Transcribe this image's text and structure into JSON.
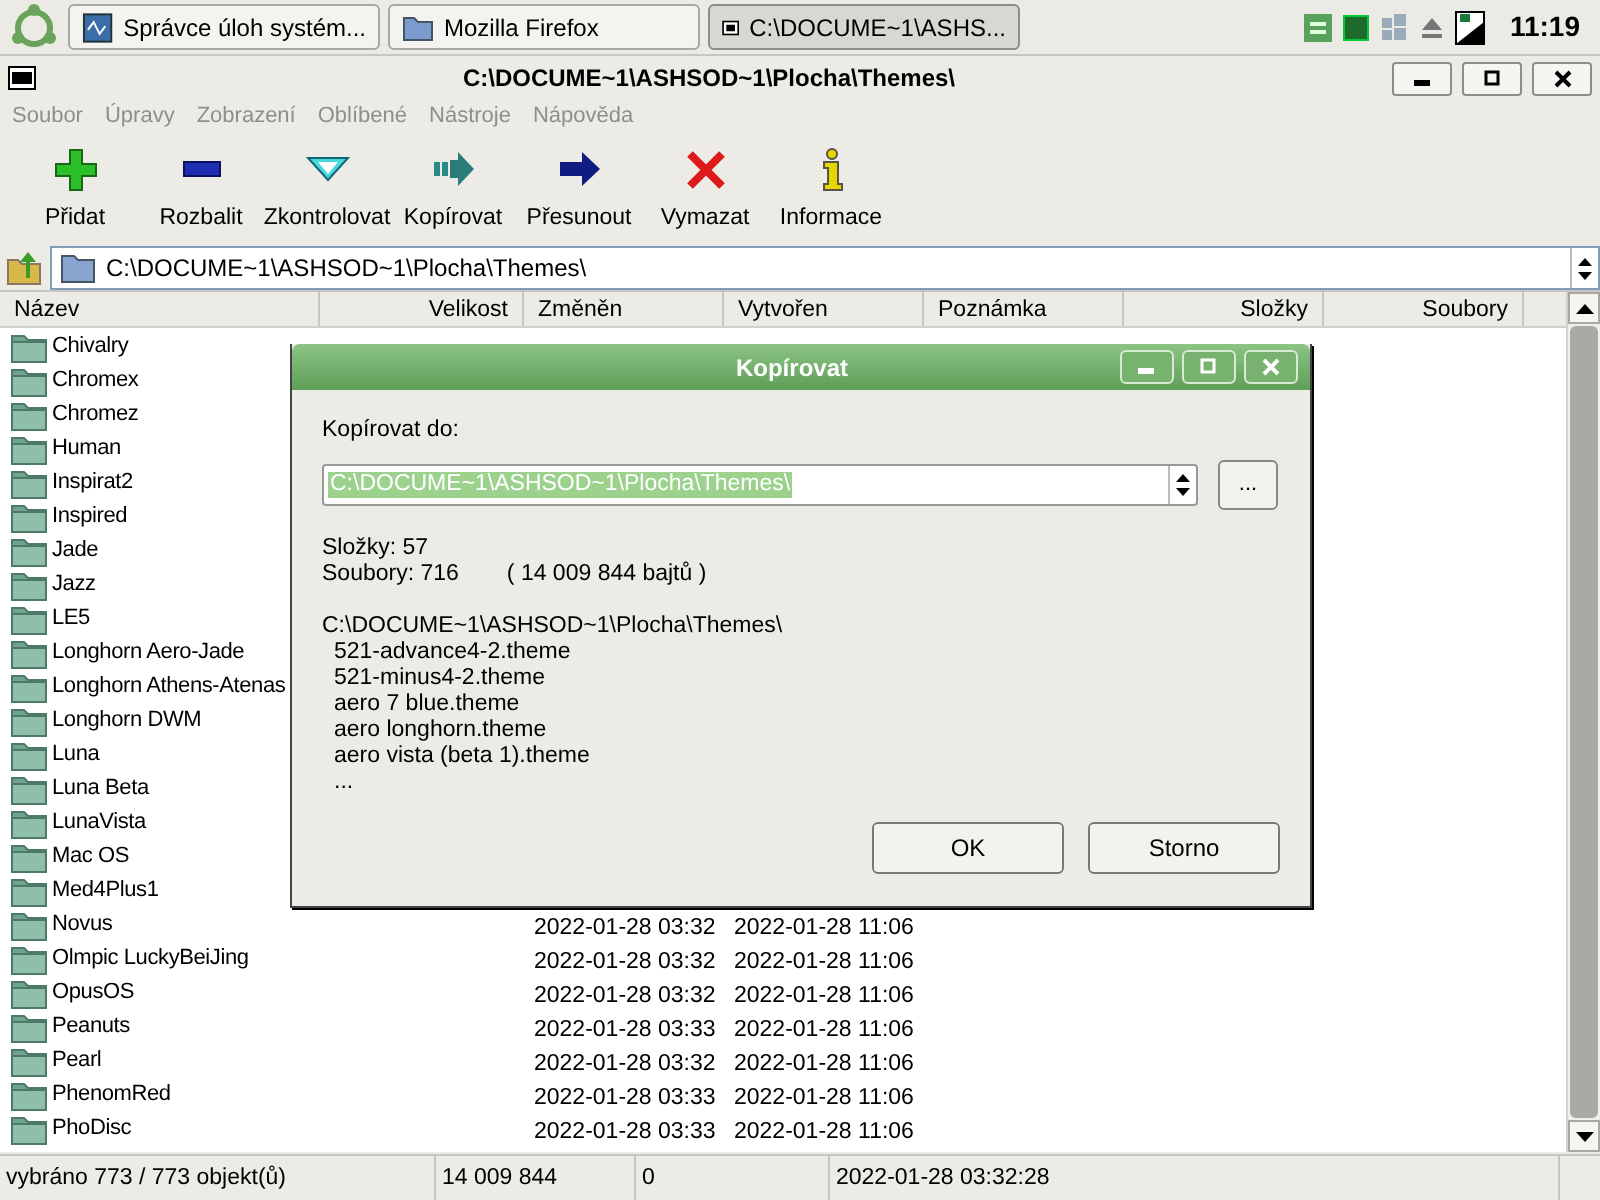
{
  "taskbar": {
    "tasks": [
      {
        "label": "Správce úloh systém...",
        "kind": "monitor",
        "selected": false
      },
      {
        "label": "Mozilla Firefox",
        "kind": "folder",
        "selected": false
      },
      {
        "label": "C:\\DOCUME~1\\ASHS...",
        "kind": "archive",
        "selected": true
      }
    ],
    "clock": "11:19"
  },
  "window": {
    "title": "C:\\DOCUME~1\\ASHSOD~1\\Plocha\\Themes\\"
  },
  "menu": [
    {
      "label": "Soubor",
      "disabled": true
    },
    {
      "label": "Úpravy",
      "disabled": true
    },
    {
      "label": "Zobrazení",
      "disabled": true
    },
    {
      "label": "Oblíbené",
      "disabled": true
    },
    {
      "label": "Nástroje",
      "disabled": true
    },
    {
      "label": "Nápověda",
      "disabled": true
    }
  ],
  "toolbar": [
    {
      "label": "Přidat",
      "kind": "add"
    },
    {
      "label": "Rozbalit",
      "kind": "extract"
    },
    {
      "label": "Zkontrolovat",
      "kind": "test"
    },
    {
      "label": "Kopírovat",
      "kind": "copy"
    },
    {
      "label": "Přesunout",
      "kind": "move"
    },
    {
      "label": "Vymazat",
      "kind": "delete"
    },
    {
      "label": "Informace",
      "kind": "info"
    }
  ],
  "address": {
    "value": "C:\\DOCUME~1\\ASHSOD~1\\Plocha\\Themes\\"
  },
  "table": {
    "columns": [
      "Název",
      "Velikost",
      "Změněn",
      "Vytvořen",
      "Poznámka",
      "Složky",
      "Soubory"
    ],
    "rows": [
      {
        "name": "Chivalry"
      },
      {
        "name": "Chromex"
      },
      {
        "name": "Chromez"
      },
      {
        "name": "Human"
      },
      {
        "name": "Inspirat2"
      },
      {
        "name": "Inspired"
      },
      {
        "name": "Jade"
      },
      {
        "name": "Jazz"
      },
      {
        "name": "LE5"
      },
      {
        "name": "Longhorn Aero-Jade"
      },
      {
        "name": "Longhorn Athens-Atenas"
      },
      {
        "name": "Longhorn DWM"
      },
      {
        "name": "Luna"
      },
      {
        "name": "Luna Beta"
      },
      {
        "name": "LunaVista"
      },
      {
        "name": "Mac OS"
      },
      {
        "name": "Med4Plus1"
      },
      {
        "name": "Novus",
        "modified": "2022-01-28 03:32",
        "created": "2022-01-28 11:06"
      },
      {
        "name": "Olmpic LuckyBeiJing",
        "modified": "2022-01-28 03:32",
        "created": "2022-01-28 11:06"
      },
      {
        "name": "OpusOS",
        "modified": "2022-01-28 03:32",
        "created": "2022-01-28 11:06"
      },
      {
        "name": "Peanuts",
        "modified": "2022-01-28 03:33",
        "created": "2022-01-28 11:06"
      },
      {
        "name": "Pearl",
        "modified": "2022-01-28 03:32",
        "created": "2022-01-28 11:06"
      },
      {
        "name": "PhenomRed",
        "modified": "2022-01-28 03:33",
        "created": "2022-01-28 11:06"
      },
      {
        "name": "PhoDisc",
        "modified": "2022-01-28 03:33",
        "created": "2022-01-28 11:06"
      }
    ]
  },
  "dialog": {
    "title": "Kopírovat",
    "label": "Kopírovat do:",
    "path_value": "C:\\DOCUME~1\\ASHSOD~1\\Plocha\\Themes\\",
    "browse": "...",
    "folders": "Složky: 57",
    "files_count": "Soubory: 716",
    "bytes": "( 14 009 844 bajtů )",
    "source": "C:\\DOCUME~1\\ASHSOD~1\\Plocha\\Themes\\",
    "files": [
      "521-advance4-2.theme",
      "521-minus4-2.theme",
      "aero 7 blue.theme",
      "aero longhorn.theme",
      "aero vista (beta 1).theme",
      "..."
    ],
    "buttons": [
      "OK",
      "Storno"
    ]
  },
  "status_bar": [
    "vybráno 773 / 773 objekt(ů)",
    "14 009 844",
    "0",
    "2022-01-28 03:32:28"
  ]
}
